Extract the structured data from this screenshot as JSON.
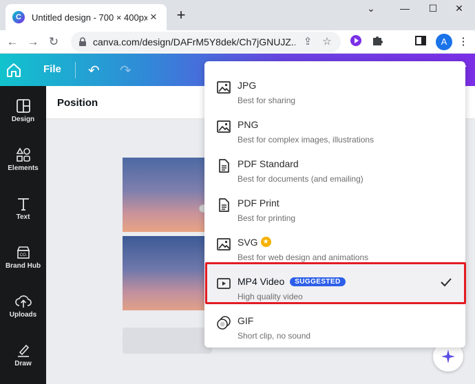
{
  "browser": {
    "tab_title": "Untitled design - 700 × 400px",
    "tab_close": "✕",
    "new_tab": "+",
    "window_controls": [
      "⌄",
      "—",
      "☐",
      "✕"
    ],
    "url": "canva.com/design/DAFrM5Y8dek/Ch7jGNUJZ...",
    "avatar_letter": "A"
  },
  "header": {
    "file_label": "File"
  },
  "rail": {
    "items": [
      {
        "label": "Design",
        "icon": "design-icon"
      },
      {
        "label": "Elements",
        "icon": "elements-icon"
      },
      {
        "label": "Text",
        "icon": "text-icon"
      },
      {
        "label": "Brand Hub",
        "icon": "brand-hub-icon"
      },
      {
        "label": "Uploads",
        "icon": "uploads-icon"
      },
      {
        "label": "Draw",
        "icon": "draw-icon"
      }
    ]
  },
  "editor": {
    "position_label": "Position"
  },
  "file_type_menu": {
    "options": [
      {
        "name": "JPG",
        "description": "Best for sharing",
        "icon": "image-icon"
      },
      {
        "name": "PNG",
        "description": "Best for complex images, illustrations",
        "icon": "image-icon"
      },
      {
        "name": "PDF Standard",
        "description": "Best for documents (and emailing)",
        "icon": "document-icon"
      },
      {
        "name": "PDF Print",
        "description": "Best for printing",
        "icon": "document-icon"
      },
      {
        "name": "SVG",
        "description": "Best for web design and animations",
        "icon": "image-icon",
        "pro": true
      },
      {
        "name": "MP4 Video",
        "description": "High quality video",
        "icon": "video-icon",
        "badge": "SUGGESTED",
        "selected": true
      },
      {
        "name": "GIF",
        "description": "Short clip, no sound",
        "icon": "gif-icon"
      }
    ]
  },
  "colors": {
    "header_gradient_start": "#11c3cd",
    "header_gradient_end": "#7b2fe6",
    "rail_bg": "#18191b",
    "badge_blue": "#2d5fe8",
    "highlight_red": "#e31b23",
    "pro_crown": "#f5b100"
  }
}
